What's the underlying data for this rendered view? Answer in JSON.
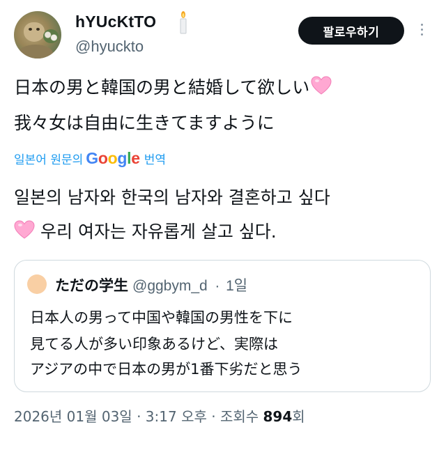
{
  "author": {
    "display_name": "hYUcKtTO",
    "handle": "@hyuckto",
    "avatar_icon": "profile-photo",
    "name_emoji_icon": "candle-icon"
  },
  "actions": {
    "follow_label": "팔로우하기",
    "more_icon": "more-vertical-icon"
  },
  "tweet": {
    "original_lines": [
      "日本の男と韓国の男と結婚して欲しい",
      "我々女は自由に生きてますように"
    ],
    "heart_emoji": "pink-heart-icon",
    "translation": {
      "prefix": "일본어 원문의",
      "provider": "Google",
      "suffix": "번역"
    },
    "translated_lines": [
      "일본의 남자와 한국의 남자와 결혼하고 싶다",
      "우리 여자는 자유롭게 살고 싶다."
    ]
  },
  "quoted_tweet": {
    "name": "ただの学生",
    "handle": "@ggbym_d",
    "separator": "·",
    "time": "1일",
    "lines": [
      "日本人の男って中国や韓国の男性を下に",
      "見てる人が多い印象あるけど、実際は",
      "アジアの中で日本の男が1番下劣だと思う"
    ]
  },
  "meta": {
    "date": "2026년 01월 03일",
    "separator": "·",
    "time": "3:17 오후",
    "views_label": "조회수",
    "views_count": "894",
    "views_suffix": "회"
  },
  "colors": {
    "text": "#0f1419",
    "secondary": "#536471",
    "link": "#1d9bf0",
    "follow_bg": "#0f1419",
    "heart": "#ff9ecb",
    "border": "#cfd9de"
  }
}
